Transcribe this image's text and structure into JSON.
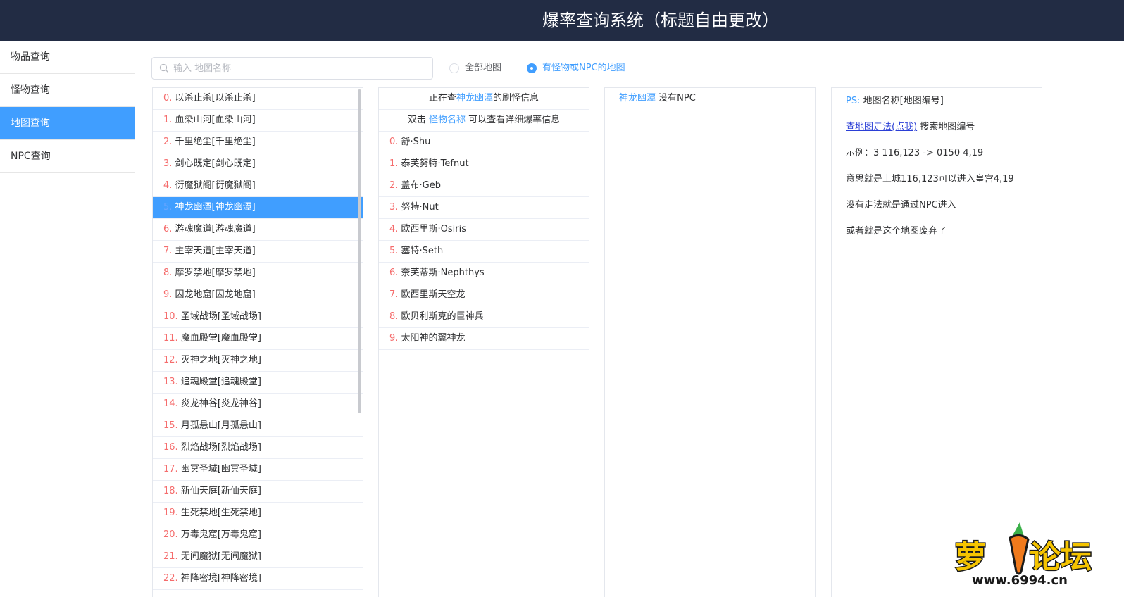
{
  "header": {
    "title": "爆率查询系统（标题自由更改）"
  },
  "sidebar": {
    "items": [
      {
        "label": "物品查询",
        "active": false
      },
      {
        "label": "怪物查询",
        "active": false
      },
      {
        "label": "地图查询",
        "active": true
      },
      {
        "label": "NPC查询",
        "active": false
      }
    ]
  },
  "search": {
    "placeholder": "输入 地图名称",
    "value": ""
  },
  "filters": {
    "all_maps": {
      "label": "全部地图",
      "checked": false
    },
    "with_monsters": {
      "label": "有怪物或NPC的地图",
      "checked": true
    }
  },
  "maps": [
    {
      "num": "0.",
      "name": "以杀止杀[以杀止杀]"
    },
    {
      "num": "1.",
      "name": "血染山河[血染山河]"
    },
    {
      "num": "2.",
      "name": "千里绝尘[千里绝尘]"
    },
    {
      "num": "3.",
      "name": "剑心既定[剑心既定]"
    },
    {
      "num": "4.",
      "name": "衍魔狱阁[衍魔狱阁]"
    },
    {
      "num": "5.",
      "name": "神龙幽潭[神龙幽潭]",
      "active": true
    },
    {
      "num": "6.",
      "name": "游魂魔道[游魂魔道]"
    },
    {
      "num": "7.",
      "name": "主宰天道[主宰天道]"
    },
    {
      "num": "8.",
      "name": "摩罗禁地[摩罗禁地]"
    },
    {
      "num": "9.",
      "name": "囚龙地窟[囚龙地窟]"
    },
    {
      "num": "10.",
      "name": "圣域战场[圣域战场]"
    },
    {
      "num": "11.",
      "name": "魔血殿堂[魔血殿堂]"
    },
    {
      "num": "12.",
      "name": "灭神之地[灭神之地]"
    },
    {
      "num": "13.",
      "name": "追魂殿堂[追魂殿堂]"
    },
    {
      "num": "14.",
      "name": "炎龙神谷[炎龙神谷]"
    },
    {
      "num": "15.",
      "name": "月孤悬山[月孤悬山]"
    },
    {
      "num": "16.",
      "name": "烈焰战场[烈焰战场]"
    },
    {
      "num": "17.",
      "name": "幽冥圣域[幽冥圣域]"
    },
    {
      "num": "18.",
      "name": "新仙天庭[新仙天庭]"
    },
    {
      "num": "19.",
      "name": "生死禁地[生死禁地]"
    },
    {
      "num": "20.",
      "name": "万毒鬼窟[万毒鬼窟]"
    },
    {
      "num": "21.",
      "name": "无间魔狱[无间魔狱]"
    },
    {
      "num": "22.",
      "name": "神降密境[神降密境]"
    }
  ],
  "monsters_panel": {
    "header_prefix": "正在查",
    "header_map": "神龙幽潭",
    "header_suffix": "的刷怪信息",
    "hint_prefix": "双击",
    "hint_link": "怪物名称",
    "hint_suffix": "可以查看详细爆率信息",
    "monsters": [
      {
        "num": "0.",
        "name": "舒·Shu"
      },
      {
        "num": "1.",
        "name": "泰芙努特·Tefnut"
      },
      {
        "num": "2.",
        "name": "盖布·Geb"
      },
      {
        "num": "3.",
        "name": "努特·Nut"
      },
      {
        "num": "4.",
        "name": "欧西里斯·Osiris"
      },
      {
        "num": "5.",
        "name": "塞特·Seth"
      },
      {
        "num": "6.",
        "name": "奈芙蒂斯·Nephthys"
      },
      {
        "num": "7.",
        "name": "欧西里斯天空龙"
      },
      {
        "num": "8.",
        "name": "欧贝利斯克的巨神兵"
      },
      {
        "num": "9.",
        "name": "太阳神的翼神龙"
      }
    ]
  },
  "npc_panel": {
    "map_name": "神龙幽潭",
    "text": "没有NPC"
  },
  "info_panel": {
    "ps_label": "PS:",
    "ps_text": "地图名称[地图编号]",
    "link_text": "查地图走法(点我)",
    "link_suffix": "搜索地图编号",
    "example": "示例：3 116,123 -> 0150 4,19",
    "meaning": "意思就是土城116,123可以进入皇宫4,19",
    "no_path": "没有走法就是通过NPC进入",
    "abandoned": "或者就是这个地图废弃了"
  },
  "watermark": {
    "logo_text": "萝卜论坛",
    "site": "www.6994.cn"
  },
  "colors": {
    "header_bg": "#222c44",
    "accent": "#409eff",
    "index": "#f56c6c"
  }
}
